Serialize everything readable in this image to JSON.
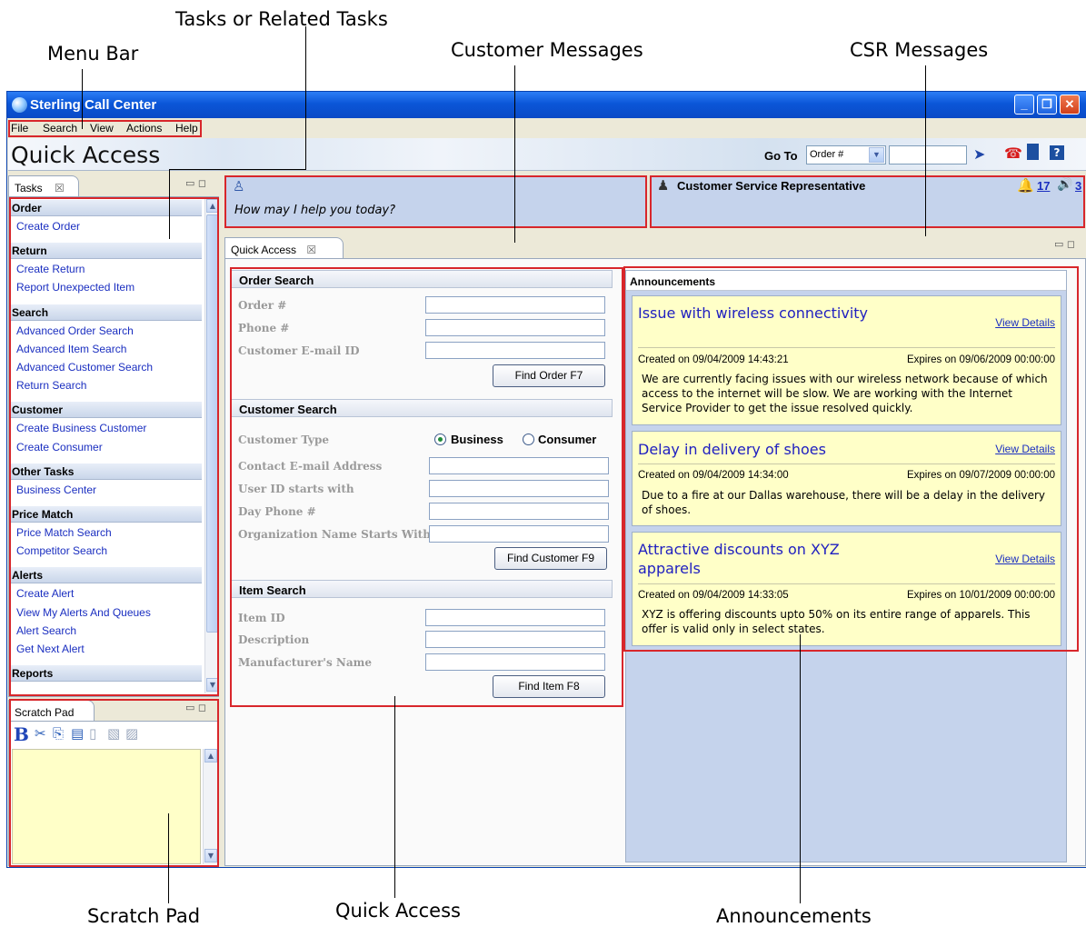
{
  "callouts": {
    "tasks": "Tasks or Related Tasks",
    "menu_bar": "Menu Bar",
    "customer_messages": "Customer Messages",
    "csr_messages": "CSR Messages",
    "scratch_pad": "Scratch Pad",
    "quick_access": "Quick Access",
    "announcements": "Announcements"
  },
  "window": {
    "title": "Sterling Call Center",
    "minimize": "_",
    "restore": "❐",
    "close": "✕"
  },
  "menu": [
    "File",
    "Search",
    "View",
    "Actions",
    "Help"
  ],
  "header": {
    "title": "Quick Access",
    "goto_label": "Go To",
    "goto_select": "Order #"
  },
  "tasks_panel": {
    "tab": "Tasks",
    "groups": [
      {
        "title": "Order",
        "items": [
          "Create Order"
        ]
      },
      {
        "title": "Return",
        "items": [
          "Create Return",
          "Report Unexpected Item"
        ]
      },
      {
        "title": "Search",
        "items": [
          "Advanced Order Search",
          "Advanced Item Search",
          "Advanced Customer Search",
          "Return Search"
        ]
      },
      {
        "title": "Customer",
        "items": [
          "Create Business Customer",
          "Create Consumer"
        ]
      },
      {
        "title": "Other Tasks",
        "items": [
          "Business Center"
        ]
      },
      {
        "title": "Price Match",
        "items": [
          "Price Match Search",
          "Competitor Search"
        ]
      },
      {
        "title": "Alerts",
        "items": [
          "Create Alert",
          "View My Alerts And Queues",
          "Alert Search",
          "Get Next Alert"
        ]
      },
      {
        "title": "Reports",
        "items": []
      }
    ]
  },
  "scratch_pad": {
    "tab": "Scratch Pad"
  },
  "customer_message": {
    "text": "How may I help you today?"
  },
  "csr": {
    "title": "Customer Service Representative",
    "alerts_count": "17",
    "queue_count": "3"
  },
  "quick_access_tab": "Quick Access",
  "order_search": {
    "title": "Order Search",
    "fields": [
      "Order #",
      "Phone #",
      "Customer E-mail ID"
    ],
    "button": "Find Order   F7"
  },
  "customer_search": {
    "title": "Customer Search",
    "type_label": "Customer Type",
    "type_options": [
      "Business",
      "Consumer"
    ],
    "type_selected": "Business",
    "fields": [
      "Contact E-mail Address",
      "User ID starts with",
      "Day Phone #",
      "Organization Name Starts With"
    ],
    "button": "Find Customer   F9"
  },
  "item_search": {
    "title": "Item Search",
    "fields": [
      "Item ID",
      "Description",
      "Manufacturer's Name"
    ],
    "button": "Find Item   F8"
  },
  "announcements": {
    "title": "Announcements",
    "items": [
      {
        "title": "Issue with wireless connectivity",
        "link": "View Details",
        "created": "Created on 09/04/2009 14:43:21",
        "expires": "Expires on 09/06/2009 00:00:00",
        "body": "We are currently facing issues with our wireless network because of which access to the internet will be slow. We are working with the Internet Service Provider to get the issue resolved quickly."
      },
      {
        "title": "Delay in delivery of shoes",
        "link": "View Details",
        "created": "Created on 09/04/2009 14:34:00",
        "expires": "Expires on 09/07/2009 00:00:00",
        "body": "Due to a fire at our Dallas warehouse, there will be a delay in the delivery of shoes."
      },
      {
        "title": "Attractive discounts on XYZ apparels",
        "link": "View Details",
        "created": "Created on 09/04/2009 14:33:05",
        "expires": "Expires on 10/01/2009 00:00:00",
        "body": "XYZ is offering discounts upto 50% on its entire range of apparels. This offer is valid only in select states."
      }
    ]
  }
}
